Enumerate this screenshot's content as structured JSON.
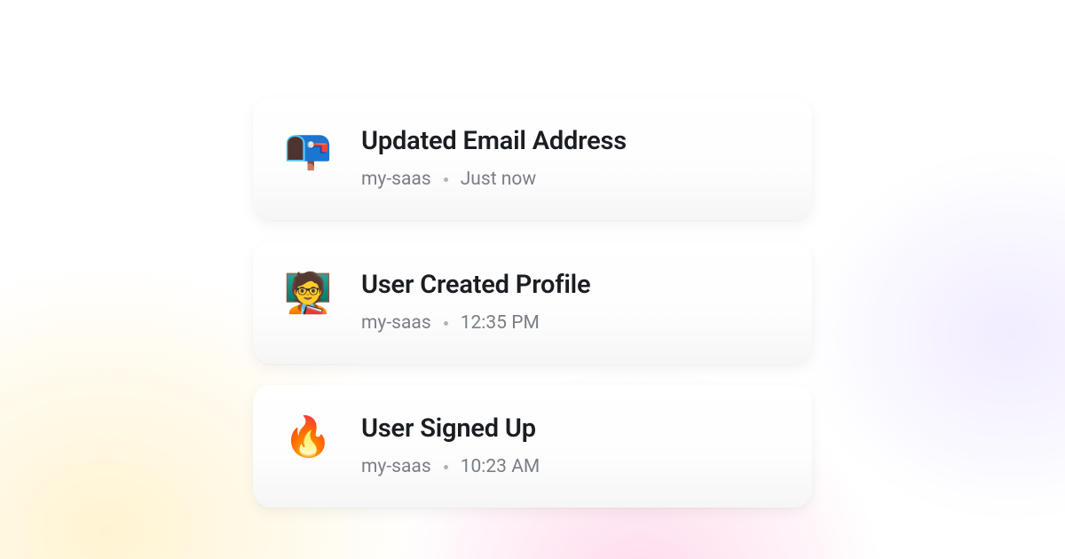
{
  "events": [
    {
      "icon": "📭",
      "icon_name": "mailbox-icon",
      "title": "Updated Email Address",
      "project": "my-saas",
      "time": "Just now"
    },
    {
      "icon": "🧑‍🏫",
      "icon_name": "teacher-icon",
      "title": "User Created Profile",
      "project": "my-saas",
      "time": "12:35 PM"
    },
    {
      "icon": "🔥",
      "icon_name": "fire-icon",
      "title": "User Signed Up",
      "project": "my-saas",
      "time": "10:23 AM"
    }
  ]
}
